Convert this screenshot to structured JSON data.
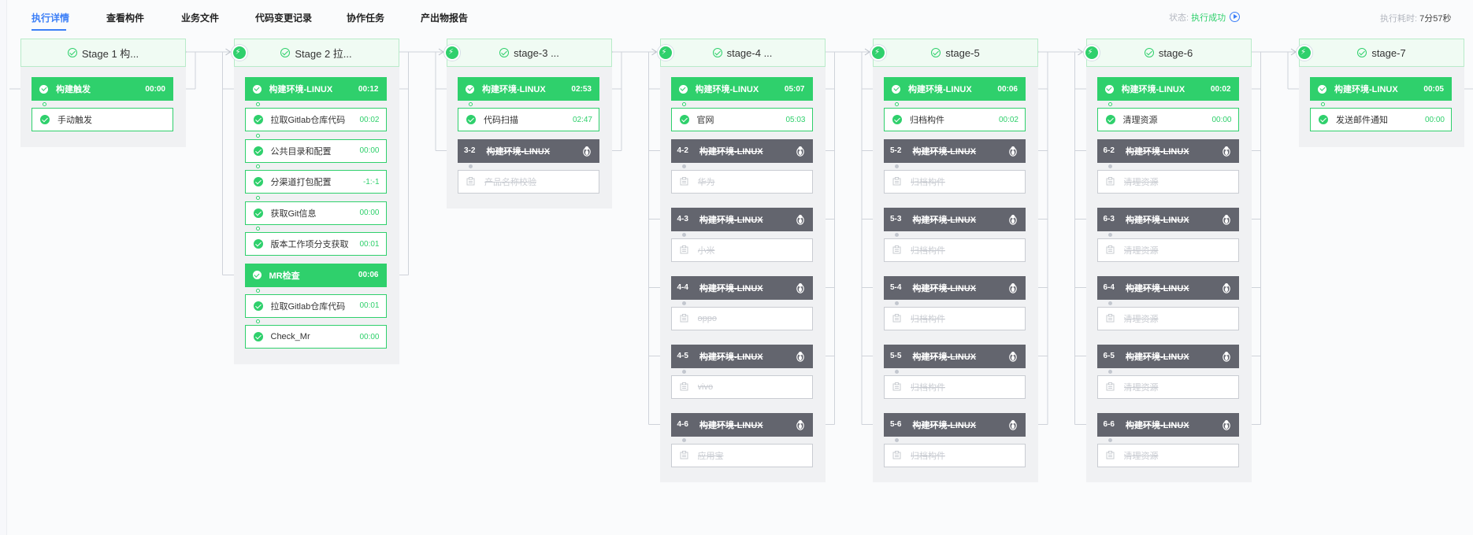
{
  "tabs": [
    {
      "label": "执行详情",
      "active": true
    },
    {
      "label": "查看构件"
    },
    {
      "label": "业务文件"
    },
    {
      "label": "代码变更记录"
    },
    {
      "label": "协作任务"
    },
    {
      "label": "产出物报告"
    }
  ],
  "status": {
    "label": "状态:",
    "value": "执行成功"
  },
  "exec_time": {
    "label": "执行耗时:",
    "value": "7分57秒"
  },
  "stages": [
    {
      "title": "Stage 1 构...",
      "jobs": [
        {
          "type": "green",
          "name": "构建触发",
          "time": "00:00",
          "tasks": [
            {
              "name": "手动触发",
              "time": "",
              "status": "ok"
            }
          ]
        }
      ]
    },
    {
      "title": "Stage 2 拉...",
      "jobs": [
        {
          "type": "green",
          "name": "构建环境-LINUX",
          "time": "00:12",
          "tasks": [
            {
              "name": "拉取Gitlab仓库代码",
              "time": "00:02",
              "status": "ok"
            },
            {
              "name": "公共目录和配置",
              "time": "00:00",
              "status": "ok"
            },
            {
              "name": "分渠道打包配置",
              "time": "-1:-1",
              "status": "ok"
            },
            {
              "name": "获取Git信息",
              "time": "00:00",
              "status": "ok"
            },
            {
              "name": "版本工作项分支获取",
              "time": "00:01",
              "status": "ok"
            }
          ]
        },
        {
          "type": "green",
          "name": "MR检查",
          "time": "00:06",
          "tasks": [
            {
              "name": "拉取Gitlab仓库代码",
              "time": "00:01",
              "status": "ok"
            },
            {
              "name": "Check_Mr",
              "time": "00:00",
              "status": "ok"
            }
          ]
        }
      ]
    },
    {
      "title": "stage-3 ...",
      "jobs": [
        {
          "type": "green",
          "name": "构建环境-LINUX",
          "time": "02:53",
          "tasks": [
            {
              "name": "代码扫描",
              "time": "02:47",
              "status": "ok"
            }
          ]
        },
        {
          "type": "gray",
          "index": "3-2",
          "name": "构建环境-LINUX",
          "tasks": [
            {
              "name": "产品名称校验",
              "status": "skip"
            }
          ]
        }
      ]
    },
    {
      "title": "stage-4 ...",
      "jobs": [
        {
          "type": "green",
          "name": "构建环境-LINUX",
          "time": "05:07",
          "tasks": [
            {
              "name": "官网",
              "time": "05:03",
              "status": "ok"
            }
          ]
        },
        {
          "type": "gray",
          "index": "4-2",
          "name": "构建环境-LINUX",
          "tasks": [
            {
              "name": "华为",
              "status": "skip"
            }
          ]
        },
        {
          "type": "gray",
          "index": "4-3",
          "name": "构建环境-LINUX",
          "tasks": [
            {
              "name": "小米",
              "status": "skip"
            }
          ]
        },
        {
          "type": "gray",
          "index": "4-4",
          "name": "构建环境-LINUX",
          "tasks": [
            {
              "name": "oppo",
              "status": "skip"
            }
          ]
        },
        {
          "type": "gray",
          "index": "4-5",
          "name": "构建环境-LINUX",
          "tasks": [
            {
              "name": "vivo",
              "status": "skip"
            }
          ]
        },
        {
          "type": "gray",
          "index": "4-6",
          "name": "构建环境-LINUX",
          "tasks": [
            {
              "name": "应用宝",
              "status": "skip"
            }
          ]
        }
      ]
    },
    {
      "title": "stage-5",
      "jobs": [
        {
          "type": "green",
          "name": "构建环境-LINUX",
          "time": "00:06",
          "tasks": [
            {
              "name": "归档构件",
              "time": "00:02",
              "status": "ok"
            }
          ]
        },
        {
          "type": "gray",
          "index": "5-2",
          "name": "构建环境-LINUX",
          "tasks": [
            {
              "name": "归档构件",
              "status": "skip"
            }
          ]
        },
        {
          "type": "gray",
          "index": "5-3",
          "name": "构建环境-LINUX",
          "tasks": [
            {
              "name": "归档构件",
              "status": "skip"
            }
          ]
        },
        {
          "type": "gray",
          "index": "5-4",
          "name": "构建环境-LINUX",
          "tasks": [
            {
              "name": "归档构件",
              "status": "skip"
            }
          ]
        },
        {
          "type": "gray",
          "index": "5-5",
          "name": "构建环境-LINUX",
          "tasks": [
            {
              "name": "归档构件",
              "status": "skip"
            }
          ]
        },
        {
          "type": "gray",
          "index": "5-6",
          "name": "构建环境-LINUX",
          "tasks": [
            {
              "name": "归档构件",
              "status": "skip"
            }
          ]
        }
      ]
    },
    {
      "title": "stage-6",
      "jobs": [
        {
          "type": "green",
          "name": "构建环境-LINUX",
          "time": "00:02",
          "tasks": [
            {
              "name": "清理资源",
              "time": "00:00",
              "status": "ok"
            }
          ]
        },
        {
          "type": "gray",
          "index": "6-2",
          "name": "构建环境-LINUX",
          "tasks": [
            {
              "name": "清理资源",
              "status": "skip"
            }
          ]
        },
        {
          "type": "gray",
          "index": "6-3",
          "name": "构建环境-LINUX",
          "tasks": [
            {
              "name": "清理资源",
              "status": "skip"
            }
          ]
        },
        {
          "type": "gray",
          "index": "6-4",
          "name": "构建环境-LINUX",
          "tasks": [
            {
              "name": "清理资源",
              "status": "skip"
            }
          ]
        },
        {
          "type": "gray",
          "index": "6-5",
          "name": "构建环境-LINUX",
          "tasks": [
            {
              "name": "清理资源",
              "status": "skip"
            }
          ]
        },
        {
          "type": "gray",
          "index": "6-6",
          "name": "构建环境-LINUX",
          "tasks": [
            {
              "name": "清理资源",
              "status": "skip"
            }
          ]
        }
      ]
    },
    {
      "title": "stage-7",
      "jobs": [
        {
          "type": "green",
          "name": "构建环境-LINUX",
          "time": "00:05",
          "tasks": [
            {
              "name": "发送邮件通知",
              "time": "00:00",
              "status": "ok"
            }
          ]
        }
      ]
    }
  ],
  "colors": {
    "success": "#2fd06c",
    "skipped": "#63656e",
    "accent": "#3c7ff7"
  }
}
